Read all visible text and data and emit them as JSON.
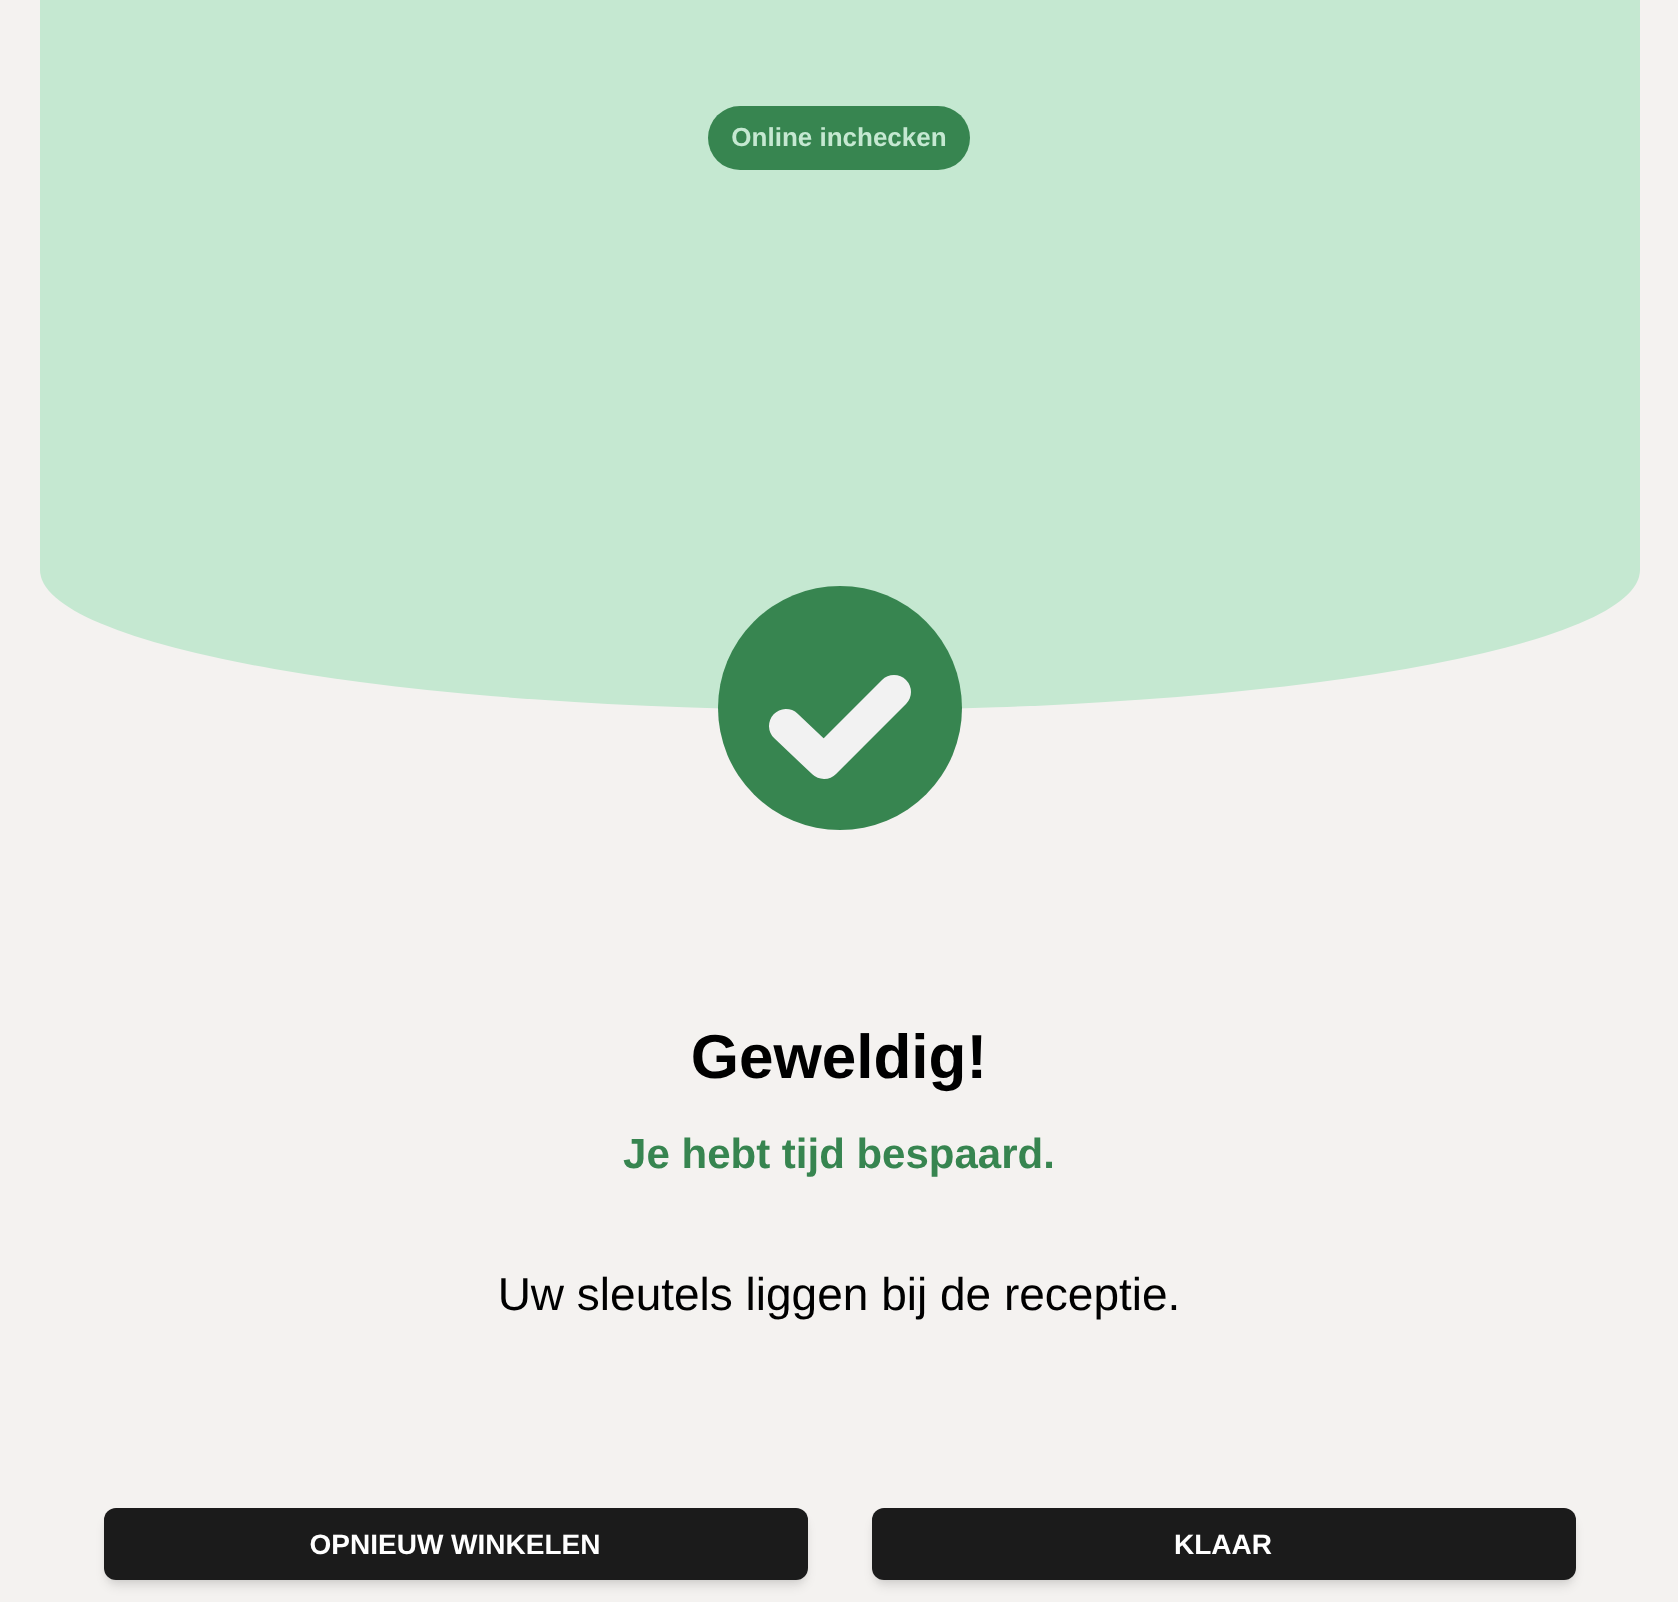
{
  "header": {
    "badge": "Online inchecken"
  },
  "title": "Geweldig!",
  "subtitle": "Je hebt tijd bespaard.",
  "message": "Uw sleutels liggen bij de receptie.",
  "buttons": [
    "OPNIEUW WINKELEN",
    "KLAAR"
  ]
}
